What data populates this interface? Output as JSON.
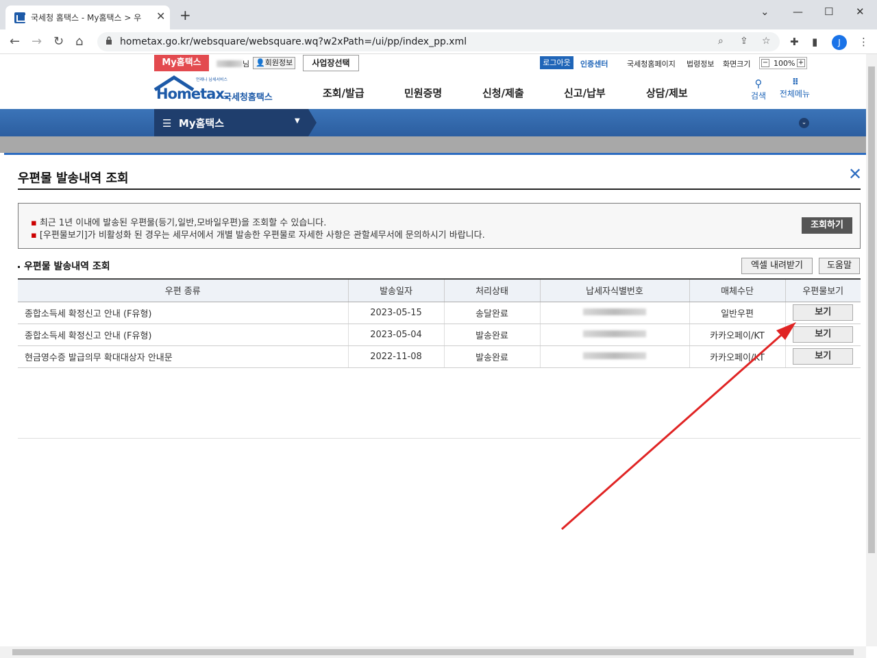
{
  "browser": {
    "tab_title": "국세청 홈택스 - My홈택스 > 우",
    "tab_close": "✕",
    "new_tab": "+",
    "url": "hometax.go.kr/websquare/websquare.wq?w2xPath=/ui/pp/index_pp.xml",
    "profile_initial": "J",
    "controls": {
      "minimize": "⌄",
      "min": "—",
      "max": "☐",
      "close": "✕"
    }
  },
  "topbar": {
    "my_hometax": "My홈택스",
    "name_suffix": "님",
    "member_info": "회원정보",
    "business_select": "사업장선택",
    "logout": "로그아웃",
    "cert_center": "인증센터",
    "links": [
      "국세청홈페이지",
      "법령정보",
      "화면크기"
    ],
    "zoom": "100%"
  },
  "header": {
    "logo_small": "언제나 납세서비스",
    "logo_text": "Hometax.",
    "logo_kor": "국세청홈택스",
    "menu": [
      "조회/발급",
      "민원증명",
      "신청/제출",
      "신고/납부",
      "상담/제보"
    ],
    "search": "검색",
    "all_menu": "전체메뉴"
  },
  "navbar": {
    "label": "My홈택스"
  },
  "modal": {
    "title": "우편물 발송내역 조회",
    "info": [
      "최근 1년 이내에 발송된 우편물(등기,일반,모바일우편)을 조회할 수 있습니다.",
      "[우편물보기]가 비활성화 된 경우는 세무서에서 개별 발송한 우편물로 자세한 사항은 관할세무서에 문의하시기 바랍니다."
    ],
    "search_button": "조회하기",
    "subtitle": "우편물 발송내역 조회",
    "excel_button": "엑셀 내려받기",
    "help_button": "도움말",
    "columns": [
      "우편 종류",
      "발송일자",
      "처리상태",
      "납세자식별번호",
      "매체수단",
      "우편물보기"
    ],
    "rows": [
      {
        "type": "종합소득세 확정신고 안내 (F유형)",
        "date": "2023-05-15",
        "status": "송달완료",
        "medium": "일반우편",
        "view": "보기"
      },
      {
        "type": "종합소득세 확정신고 안내 (F유형)",
        "date": "2023-05-04",
        "status": "발송완료",
        "medium": "카카오페이/KT",
        "view": "보기"
      },
      {
        "type": "현금영수증 발급의무 확대대상자 안내문",
        "date": "2022-11-08",
        "status": "발송완료",
        "medium": "카카오페이/KT",
        "view": "보기"
      }
    ]
  },
  "colors": {
    "accent": "#2d6cc0",
    "my_tab": "#e34a4f",
    "annotation": "#e02424"
  }
}
